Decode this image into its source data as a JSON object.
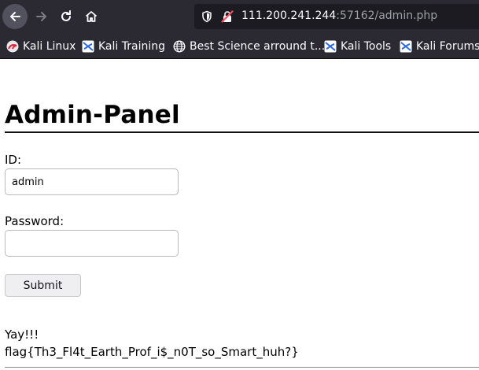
{
  "browser": {
    "url_host": "111.200.241.244",
    "url_rest": ":57162/admin.php",
    "icons": {
      "back": "arrow-left-icon",
      "forward": "arrow-right-icon",
      "reload": "reload-icon",
      "home": "home-icon",
      "site_info": "shield-icon",
      "insecure": "insecure-lock-icon"
    }
  },
  "bookmarks": [
    {
      "label": "Kali Linux",
      "icon": "kali-icon"
    },
    {
      "label": "Kali Training",
      "icon": "kali-icon"
    },
    {
      "label": "Best Science arround t...",
      "icon": "globe-icon"
    },
    {
      "label": "Kali Tools",
      "icon": "kali-icon"
    },
    {
      "label": "Kali Forums",
      "icon": "kali-icon"
    }
  ],
  "page": {
    "title": "Admin-Panel",
    "id_label": "ID:",
    "id_value": "admin",
    "password_label": "Password:",
    "password_value": "",
    "submit_label": "Submit",
    "result_line1": "Yay!!!",
    "result_line2": "flag{Th3_Fl4t_Earth_Prof_i$_n0T_so_Smart_huh?}"
  }
}
